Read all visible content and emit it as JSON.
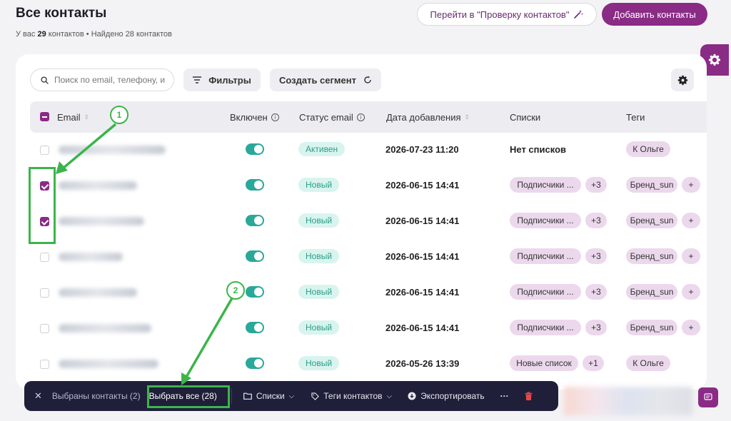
{
  "header": {
    "title": "Все контакты",
    "subtitle_prefix": "У вас ",
    "total_count": "29",
    "subtitle_suffix": " контактов • Найдено 28 контактов",
    "check_button": "Перейти в \"Проверку контактов\"",
    "add_button": "Добавить контакты"
  },
  "toolbar": {
    "search_placeholder": "Поиск по email, телефону, и",
    "filters_label": "Фильтры",
    "create_segment_label": "Создать сегмент"
  },
  "table": {
    "columns": [
      "Email",
      "Включен",
      "Статус email",
      "Дата добавления",
      "Списки",
      "Теги"
    ],
    "rows": [
      {
        "checked": false,
        "status": "Активен",
        "date": "2026-07-23 11:20",
        "list": "Нет списков",
        "list_extra": "",
        "tag": "К Ольге",
        "tag_extra": ""
      },
      {
        "checked": true,
        "status": "Новый",
        "date": "2026-06-15 14:41",
        "list": "Подписчики ...",
        "list_extra": "+3",
        "tag": "Бренд_sun",
        "tag_extra": "+"
      },
      {
        "checked": true,
        "status": "Новый",
        "date": "2026-06-15 14:41",
        "list": "Подписчики ...",
        "list_extra": "+3",
        "tag": "Бренд_sun",
        "tag_extra": "+"
      },
      {
        "checked": false,
        "status": "Новый",
        "date": "2026-06-15 14:41",
        "list": "Подписчики ...",
        "list_extra": "+3",
        "tag": "Бренд_sun",
        "tag_extra": "+"
      },
      {
        "checked": false,
        "status": "Новый",
        "date": "2026-06-15 14:41",
        "list": "Подписчики ...",
        "list_extra": "+3",
        "tag": "Бренд_sun",
        "tag_extra": "+"
      },
      {
        "checked": false,
        "status": "Новый",
        "date": "2026-06-15 14:41",
        "list": "Подписчики ...",
        "list_extra": "+3",
        "tag": "Бренд_sun",
        "tag_extra": "+"
      },
      {
        "checked": false,
        "status": "Новый",
        "date": "2026-05-26 13:39",
        "list": "Новые список",
        "list_extra": "+1",
        "tag": "К Ольге",
        "tag_extra": ""
      }
    ]
  },
  "bulk_bar": {
    "selected_label": "Выбраны контакты (2)",
    "select_all_label": "Выбрать все (28)",
    "lists_label": "Списки",
    "tags_label": "Теги контактов",
    "export_label": "Экспортировать",
    "more_label": "···"
  },
  "annotations": {
    "marker_1": "1",
    "marker_2": "2",
    "color": "#3bb54a"
  },
  "colors": {
    "brand": "#8a2b86",
    "toggle_on": "#2aa89a",
    "status_bg": "#d9f4ee",
    "chip_bg": "#ecd8ec",
    "bar_bg": "#1f1f3a"
  }
}
